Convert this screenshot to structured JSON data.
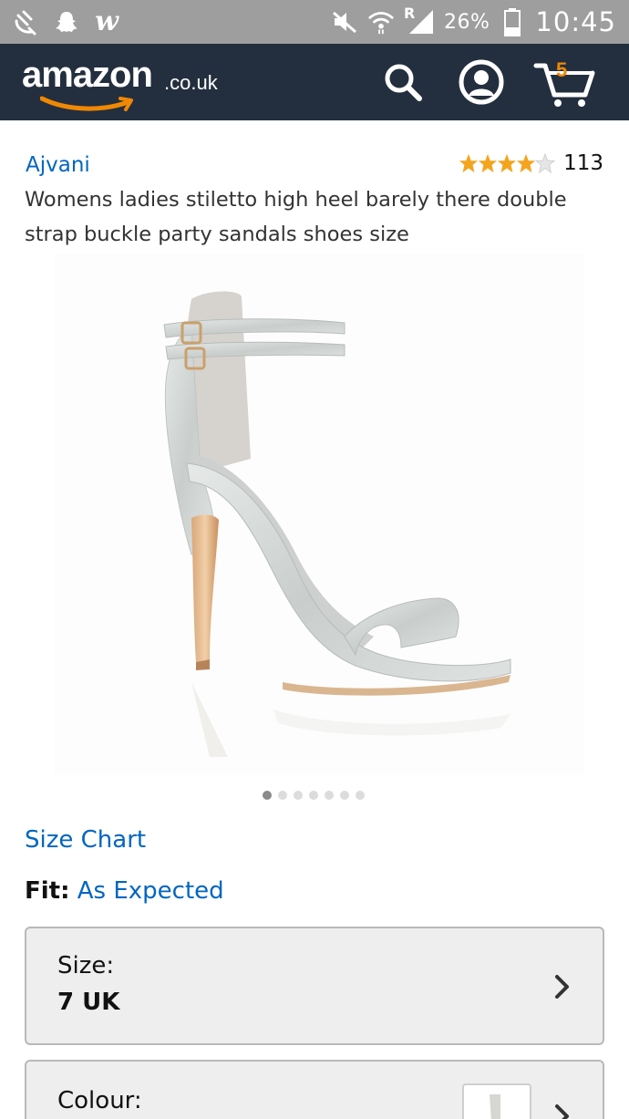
{
  "status_bar": {
    "battery_percent": "26%",
    "time": "10:45",
    "network_label": "R",
    "w_app_glyph": "w",
    "left_icons": [
      "satellite-dish-icon",
      "snapchat-ghost-icon",
      "w-app-icon"
    ],
    "right_icons": [
      "mute-icon",
      "wifi-icon",
      "signal-icon",
      "battery-icon"
    ]
  },
  "header": {
    "logo_text": "amazon",
    "logo_tld": ".co.uk",
    "cart_count": "5",
    "icons": [
      "search-icon",
      "account-icon",
      "cart-icon"
    ],
    "background": "#232f3e",
    "accent": "#f08804"
  },
  "product": {
    "brand": "Ajvani",
    "rating_count": "113",
    "rating_stars": 4,
    "title": "Womens ladies stiletto high heel barely there double strap buckle party sandals shoes size",
    "image_alt_icon": "sandal-image",
    "image_count": 7,
    "image_index": 1
  },
  "links": {
    "size_chart": "Size Chart",
    "fit_label": "Fit:",
    "fit_value": "As Expected"
  },
  "selectors": {
    "size_label": "Size:",
    "size_value": "7 UK",
    "colour_label": "Colour:"
  },
  "colors": {
    "link": "#0066c0",
    "star": "#f4a41d",
    "status_bar": "#9e9e9e"
  }
}
